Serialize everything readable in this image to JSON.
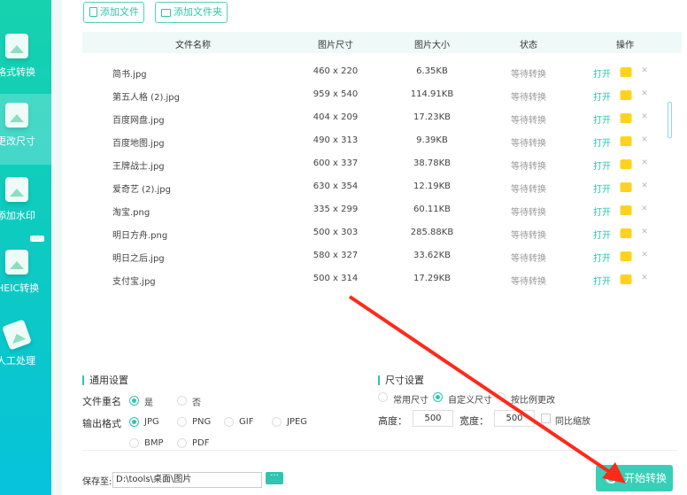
{
  "sidebar": {
    "items": [
      {
        "label": "格式转换",
        "active": false
      },
      {
        "label": "更改尺寸",
        "active": true
      },
      {
        "label": "添加水印",
        "active": false
      },
      {
        "label": "HEIC转换",
        "active": false,
        "badge": "VIP"
      },
      {
        "label": "人工处理",
        "active": false
      }
    ]
  },
  "toolbar": {
    "add_file": "添加文件",
    "add_folder": "添加文件夹"
  },
  "table": {
    "headers": [
      "文件名称",
      "图片尺寸",
      "图片大小",
      "状态",
      "操作"
    ],
    "rows": [
      {
        "name": "简书.jpg",
        "dims": "460 x 220",
        "size": "6.35KB",
        "status": "等待转换",
        "open": "打开"
      },
      {
        "name": "第五人格 (2).jpg",
        "dims": "959 x 540",
        "size": "114.91KB",
        "status": "等待转换",
        "open": "打开"
      },
      {
        "name": "百度网盘.jpg",
        "dims": "404 x 209",
        "size": "17.23KB",
        "status": "等待转换",
        "open": "打开"
      },
      {
        "name": "百度地图.jpg",
        "dims": "490 x 313",
        "size": "9.39KB",
        "status": "等待转换",
        "open": "打开"
      },
      {
        "name": "王牌战士.jpg",
        "dims": "600 x 337",
        "size": "38.78KB",
        "status": "等待转换",
        "open": "打开"
      },
      {
        "name": "爱奇艺 (2).jpg",
        "dims": "630 x 354",
        "size": "12.19KB",
        "status": "等待转换",
        "open": "打开"
      },
      {
        "name": "淘宝.png",
        "dims": "335 x 299",
        "size": "60.11KB",
        "status": "等待转换",
        "open": "打开"
      },
      {
        "name": "明日方舟.png",
        "dims": "500 x 303",
        "size": "285.88KB",
        "status": "等待转换",
        "open": "打开"
      },
      {
        "name": "明日之后.jpg",
        "dims": "580 x 327",
        "size": "33.62KB",
        "status": "等待转换",
        "open": "打开"
      },
      {
        "name": "支付宝.jpg",
        "dims": "500 x 314",
        "size": "17.29KB",
        "status": "等待转换",
        "open": "打开"
      }
    ]
  },
  "general": {
    "title": "通用设置",
    "rename_label": "文件重名",
    "rename_yes": "是",
    "rename_no": "否",
    "rename_selected": "是",
    "format_label": "输出格式",
    "formats": [
      "JPG",
      "PNG",
      "GIF",
      "JPEG",
      "BMP",
      "PDF"
    ],
    "format_selected": "JPG"
  },
  "size": {
    "title": "尺寸设置",
    "modes": [
      "常用尺寸",
      "自定义尺寸",
      "按比例更改"
    ],
    "mode_selected": "自定义尺寸",
    "height_label": "高度：",
    "height": "500",
    "width_label": "宽度：",
    "width": "500",
    "proportional": "同比缩放",
    "proportional_checked": false
  },
  "save": {
    "label": "保存至:",
    "path": "D:\\tools\\桌面\\图片",
    "browse": "···"
  },
  "start_button": "开始转换",
  "colors": {
    "accent": "#2fc5ae",
    "folder": "#ffd21e",
    "annotation_arrow": "#ff2a1a"
  }
}
